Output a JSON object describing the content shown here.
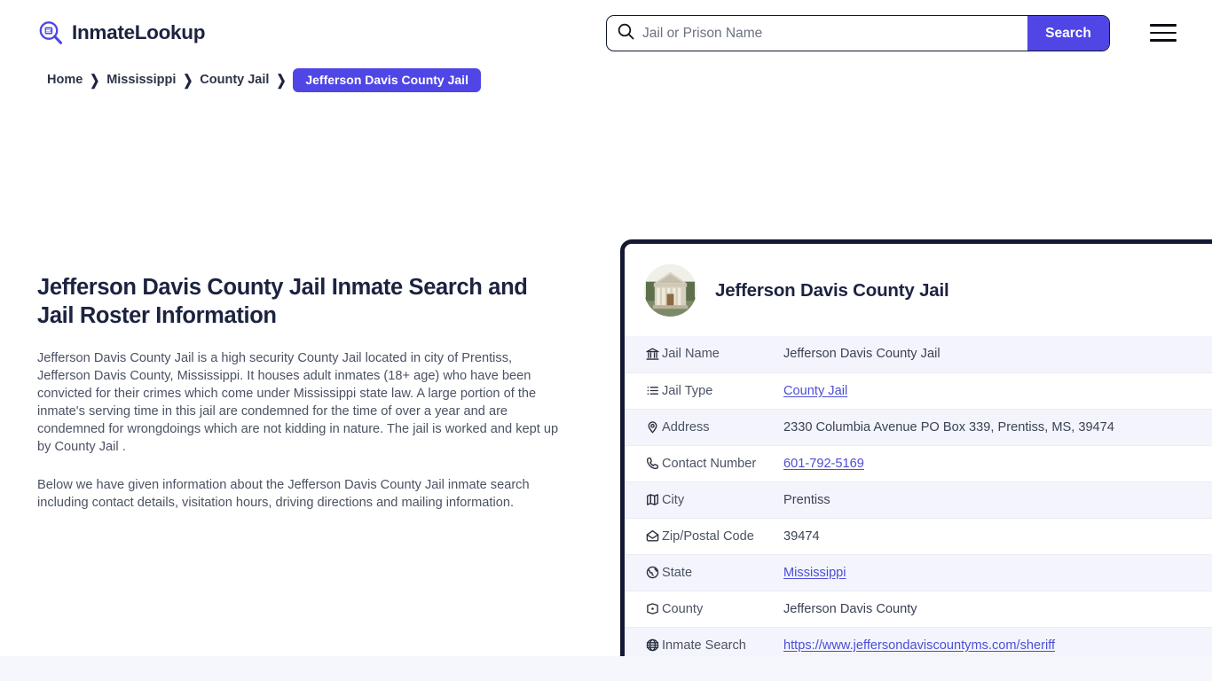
{
  "header": {
    "brand_name": "InmateLookup",
    "brand_icon": "magnifier-list-logo-icon",
    "menu_icon": "hamburger-menu-icon",
    "search": {
      "icon": "search-icon",
      "placeholder": "Jail or Prison Name",
      "value": "",
      "button_label": "Search",
      "button_color": "#4f46e5"
    }
  },
  "breadcrumb": {
    "items": [
      {
        "label": "Home",
        "current": false
      },
      {
        "label": "Mississippi",
        "current": false
      },
      {
        "label": "County Jail",
        "current": false
      },
      {
        "label": "Jefferson Davis County Jail",
        "current": true
      }
    ],
    "separator": "❯",
    "active_color": "#4f46e5"
  },
  "main": {
    "page_title": "Jefferson Davis County Jail Inmate Search and Jail Roster Information",
    "paragraph_1": "Jefferson Davis County Jail is a high security County Jail located in city of Prentiss, Jefferson Davis County, Mississippi. It houses adult inmates (18+ age) who have been convicted for their crimes which come under Mississippi state law. A large portion of the inmate's serving time in this jail are condemned for the time of over a year and are condemned for wrongdoings which are not kidding in nature. The jail is worked and kept up by County Jail .",
    "paragraph_2": "Below we have given information about the Jefferson Davis County Jail inmate search including contact details, visitation hours, driving directions and mailing information."
  },
  "info_card": {
    "border_color": "#141a33",
    "avatar_icon": "courthouse-photo",
    "title": "Jefferson Davis County Jail",
    "rows": [
      {
        "icon": "bank-icon",
        "label": "Jail Name",
        "value": "Jefferson Davis County Jail",
        "link": false
      },
      {
        "icon": "list-icon",
        "label": "Jail Type",
        "value": "County Jail",
        "link": true
      },
      {
        "icon": "map-pin-icon",
        "label": "Address",
        "value": "2330 Columbia Avenue PO Box 339, Prentiss, MS, 39474",
        "link": false
      },
      {
        "icon": "phone-icon",
        "label": "Contact Number",
        "value": "601-792-5169",
        "link": true
      },
      {
        "icon": "map-icon",
        "label": "City",
        "value": "Prentiss",
        "link": false
      },
      {
        "icon": "envelope-icon",
        "label": "Zip/Postal Code",
        "value": "39474",
        "link": false
      },
      {
        "icon": "globe-state-icon",
        "label": "State",
        "value": "Mississippi",
        "link": true
      },
      {
        "icon": "map-area-icon",
        "label": "County",
        "value": "Jefferson Davis County",
        "link": false
      },
      {
        "icon": "globe-icon",
        "label": "Inmate Search",
        "value": "https://www.jeffersondaviscountyms.com/sheriff",
        "link": true
      }
    ]
  }
}
